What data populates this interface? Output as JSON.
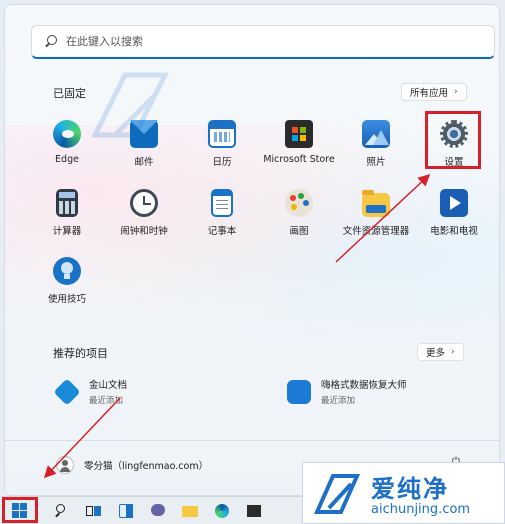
{
  "search": {
    "placeholder": "在此键入以搜索"
  },
  "pinned": {
    "title": "已固定",
    "all_apps_label": "所有应用",
    "apps": [
      {
        "label": "Edge",
        "icon": "edge-icon"
      },
      {
        "label": "邮件",
        "icon": "mail-icon"
      },
      {
        "label": "日历",
        "icon": "calendar-icon"
      },
      {
        "label": "Microsoft Store",
        "icon": "store-icon"
      },
      {
        "label": "照片",
        "icon": "photos-icon"
      },
      {
        "label": "设置",
        "icon": "settings-icon"
      },
      {
        "label": "计算器",
        "icon": "calculator-icon"
      },
      {
        "label": "闹钟和时钟",
        "icon": "clock-icon"
      },
      {
        "label": "记事本",
        "icon": "notepad-icon"
      },
      {
        "label": "画图",
        "icon": "paint-icon"
      },
      {
        "label": "文件资源管理器",
        "icon": "file-explorer-icon"
      },
      {
        "label": "电影和电视",
        "icon": "movies-icon"
      },
      {
        "label": "使用技巧",
        "icon": "tips-icon"
      }
    ]
  },
  "recommended": {
    "title": "推荐的项目",
    "more_label": "更多",
    "items": [
      {
        "name": "金山文档",
        "sub": "最近添加"
      },
      {
        "name": "嗨格式数据恢复大师",
        "sub": "最近添加"
      }
    ]
  },
  "user": {
    "name": "零分猫（lingfenmao.com）"
  },
  "watermark": {
    "cn": "爱纯净",
    "en": "aichunjing.com"
  },
  "colors": {
    "highlight": "#d6212b",
    "accent": "#0a6cbd",
    "brand": "#1d6fc7"
  }
}
